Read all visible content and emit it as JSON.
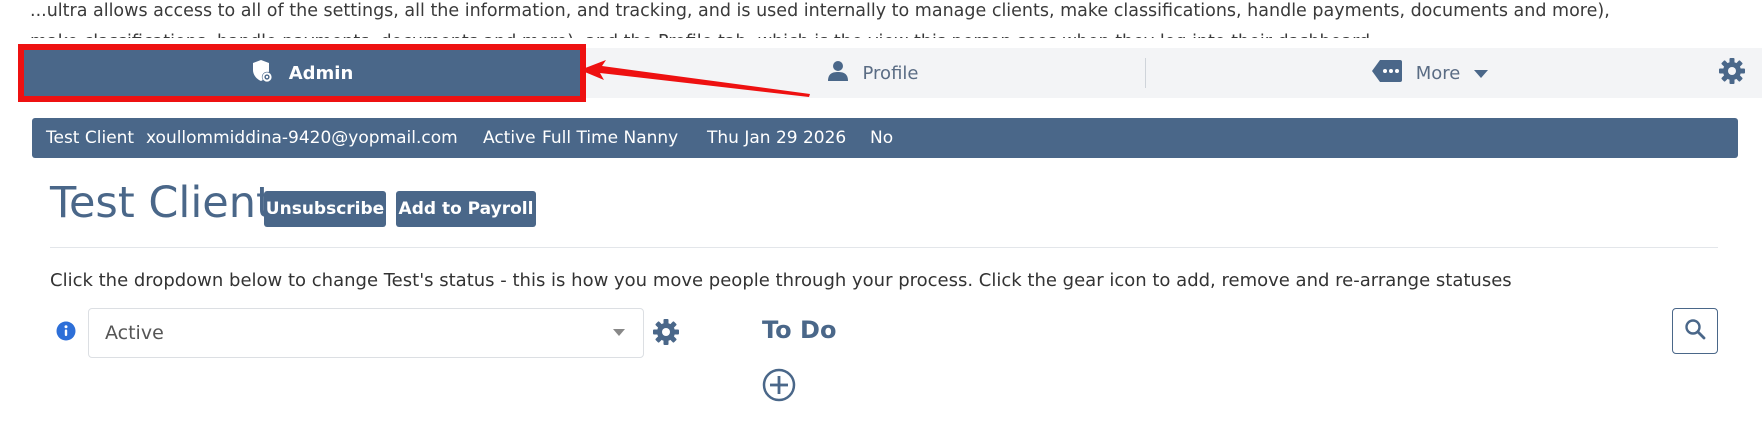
{
  "intro": {
    "line1": "...ultra allows access to all of the settings, all the information, and tracking, and is used internally to manage clients, make classifications, handle payments, documents and more),",
    "line2": "make classifications, handle payments, documents and more), and the Profile tab, which is the view this person sees when they log into their dashboard"
  },
  "tabs": {
    "admin": "Admin",
    "profile": "Profile",
    "more": "More"
  },
  "infobar": {
    "name": "Test Client",
    "email": "xoullommiddina-9420@yopmail.com",
    "status": "Active",
    "type": "Full Time Nanny",
    "date": "Thu Jan 29 2026",
    "flag": "No"
  },
  "header": {
    "title": "Test Client",
    "unsubscribe": "Unsubscribe",
    "add_payroll": "Add to Payroll"
  },
  "help_text": "Click the dropdown below to change Test's status - this is how you move people through your process. Click the gear icon to add, remove and re-arrange statuses",
  "status": {
    "selected": "Active"
  },
  "todo": {
    "title": "To Do"
  },
  "colors": {
    "primary": "#4a6789",
    "highlight": "#ee1111",
    "info_icon": "#2d6fd8"
  }
}
